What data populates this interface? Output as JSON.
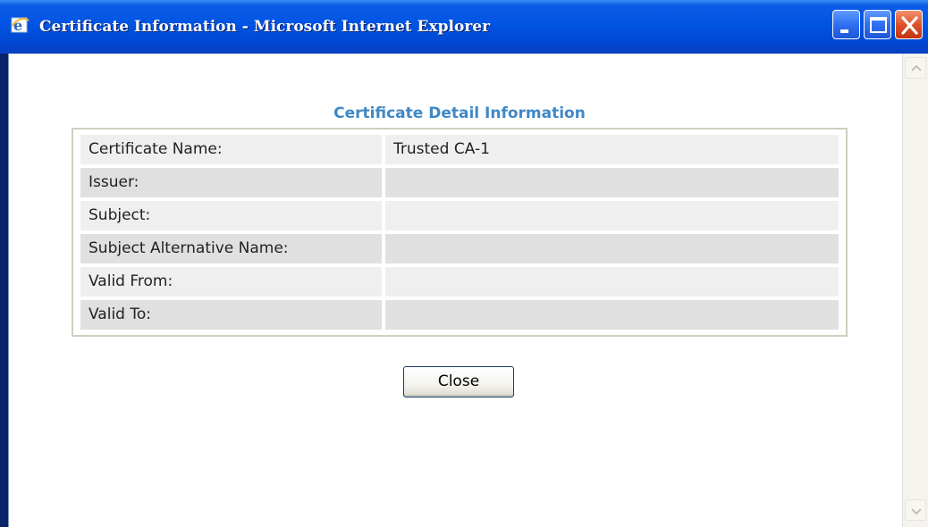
{
  "window": {
    "title": "Certificate Information - Microsoft Internet Explorer"
  },
  "page": {
    "heading": "Certificate Detail Information",
    "rows": [
      {
        "label": "Certificate Name:",
        "value": "Trusted CA-1"
      },
      {
        "label": "Issuer:",
        "value": ""
      },
      {
        "label": "Subject:",
        "value": ""
      },
      {
        "label": "Subject Alternative Name:",
        "value": ""
      },
      {
        "label": "Valid From:",
        "value": ""
      },
      {
        "label": "Valid To:",
        "value": ""
      }
    ],
    "close_label": "Close"
  },
  "colors": {
    "heading": "#3f88c6",
    "titlebar": "#0054e3",
    "row_light": "#efefef",
    "row_dark": "#e0e0e0"
  },
  "icons": {
    "app": "ie-icon",
    "minimize": "minimize-icon",
    "maximize": "maximize-icon",
    "close": "close-icon",
    "scroll_up": "chevron-up-icon",
    "scroll_down": "chevron-down-icon"
  }
}
